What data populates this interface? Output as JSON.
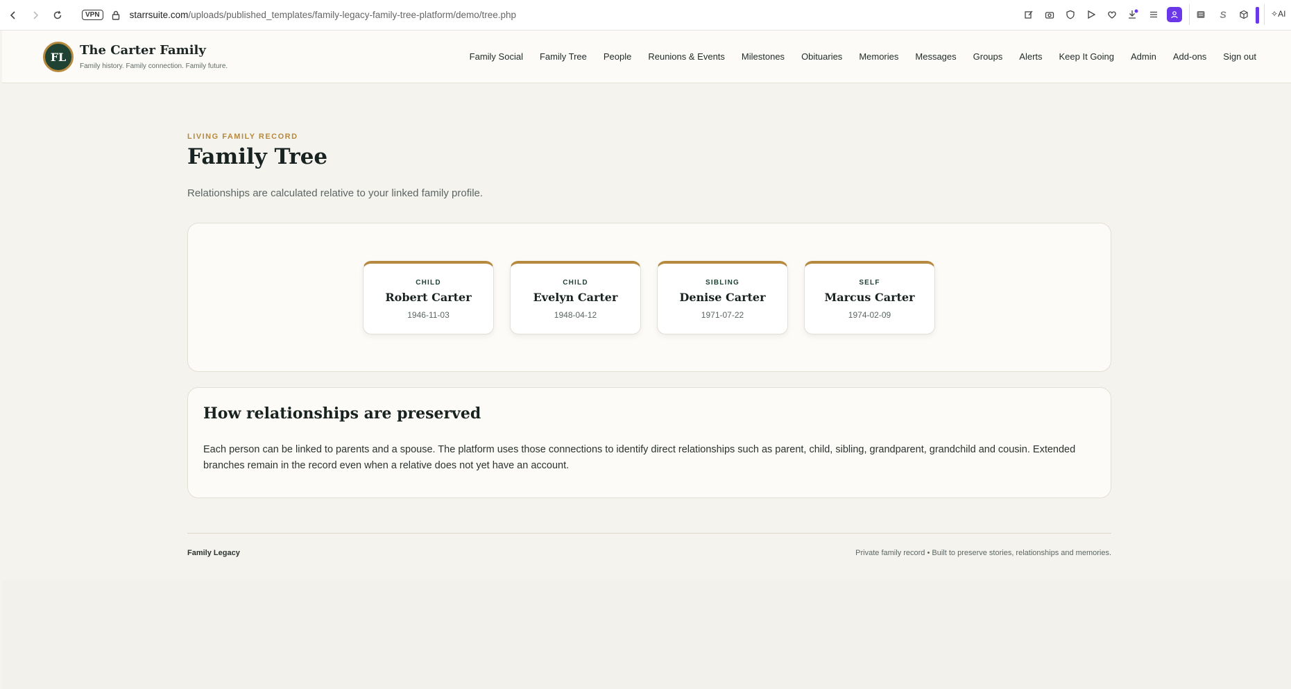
{
  "browser": {
    "url_host": "starrsuite.com",
    "url_path": "/uploads/published_templates/family-legacy-family-tree-platform/demo/tree.php",
    "vpn_label": "VPN",
    "ai_label": "AI"
  },
  "site": {
    "logo_initials": "FL",
    "title": "The Carter Family",
    "tagline": "Family history. Family connection. Family future."
  },
  "nav": [
    "Family Social",
    "Family Tree",
    "People",
    "Reunions & Events",
    "Milestones",
    "Obituaries",
    "Memories",
    "Messages",
    "Groups",
    "Alerts",
    "Keep It Going",
    "Admin",
    "Add-ons",
    "Sign out"
  ],
  "page": {
    "eyebrow": "LIVING FAMILY RECORD",
    "title": "Family Tree",
    "subtitle": "Relationships are calculated relative to your linked family profile."
  },
  "people": [
    {
      "role": "CHILD",
      "name": "Robert Carter",
      "date": "1946-11-03"
    },
    {
      "role": "CHILD",
      "name": "Evelyn Carter",
      "date": "1948-04-12"
    },
    {
      "role": "SIBLING",
      "name": "Denise Carter",
      "date": "1971-07-22"
    },
    {
      "role": "SELF",
      "name": "Marcus Carter",
      "date": "1974-02-09"
    }
  ],
  "info": {
    "title": "How relationships are preserved",
    "body": "Each person can be linked to parents and a spouse. The platform uses those connections to identify direct relationships such as parent, child, sibling, grandparent, grandchild and cousin. Extended branches remain in the record even when a relative does not yet have an account."
  },
  "footer": {
    "left": "Family Legacy",
    "right": "Private family record • Built to preserve stories, relationships and memories."
  },
  "colors": {
    "accent_gold": "#b68a3e",
    "brand_green": "#1f4233",
    "page_bg": "#f5f3ee",
    "browser_accent": "#6a38e8"
  }
}
